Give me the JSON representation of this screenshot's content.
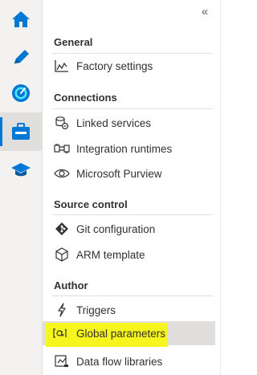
{
  "rail": {
    "items": [
      {
        "icon": "home-icon"
      },
      {
        "icon": "pencil-icon"
      },
      {
        "icon": "monitor-gauge-icon"
      },
      {
        "icon": "manage-toolbox-icon",
        "active": true
      },
      {
        "icon": "learning-center-icon"
      }
    ]
  },
  "panel": {
    "collapse_label": "«",
    "sections": {
      "general": "General",
      "connections": "Connections",
      "source_control": "Source control",
      "author": "Author"
    },
    "items": {
      "factory_settings": "Factory settings",
      "linked_services": "Linked services",
      "integration_runtimes": "Integration runtimes",
      "purview": "Microsoft Purview",
      "git_configuration": "Git configuration",
      "arm_template": "ARM template",
      "triggers": "Triggers",
      "global_parameters": "Global parameters",
      "data_flow_libraries": "Data flow libraries"
    }
  },
  "colors": {
    "accent": "#0078d4",
    "highlight": "#f6f61e",
    "selected_bg": "#e1dfdd"
  }
}
